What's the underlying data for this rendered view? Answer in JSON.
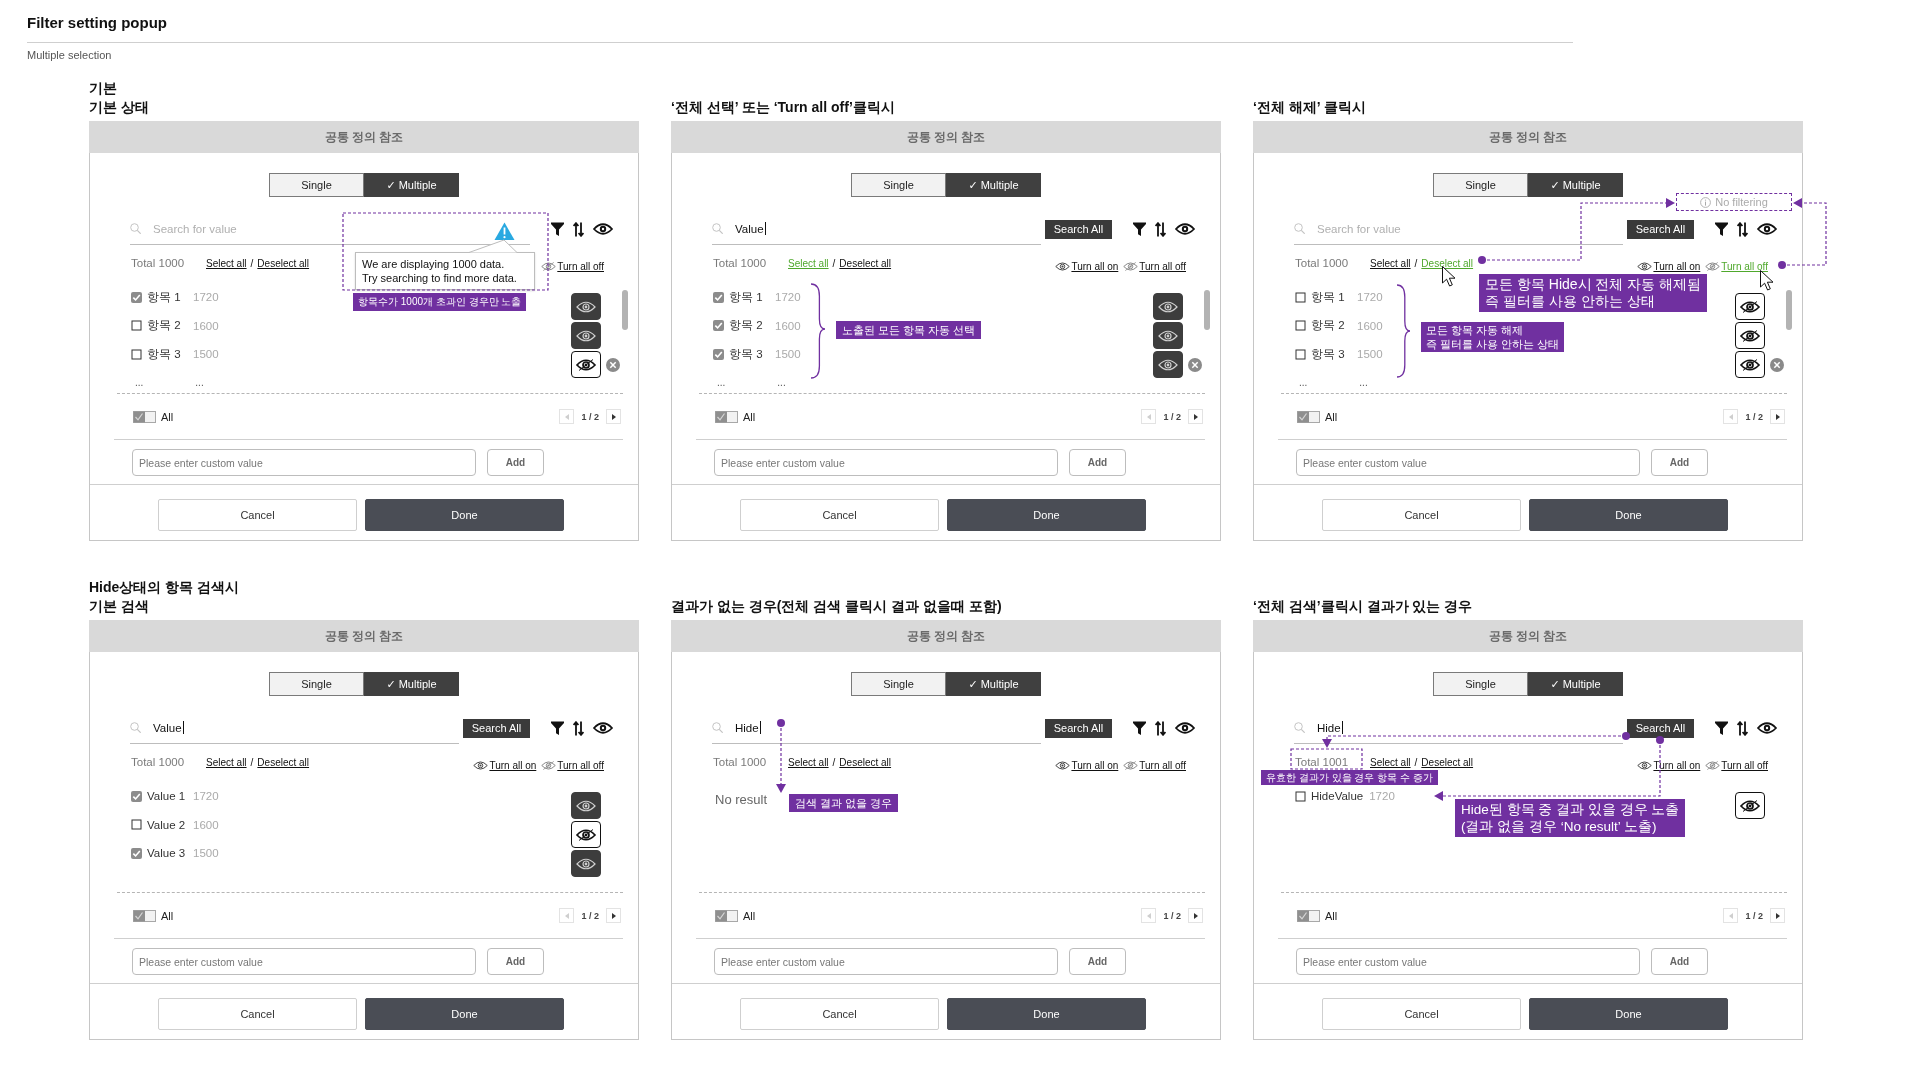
{
  "page": {
    "title": "Filter setting popup",
    "subtitle": "Multiple selection"
  },
  "panels": [
    {
      "headings": [
        "기본",
        "기본 상태"
      ],
      "popup": {
        "header": "공통 정의 참조",
        "modes": [
          {
            "label": "Single",
            "selected": false
          },
          {
            "label": "✓ Multiple",
            "selected": true
          }
        ],
        "search": {
          "placeholder": "Search for value"
        },
        "total": "Total 1000",
        "bulk": {
          "select": {
            "label": "Select all",
            "highlighted": false
          },
          "separator": "/",
          "deselect": {
            "label": "Deselect all",
            "highlighted": false
          }
        },
        "visibility_links": [
          {
            "kind": "off",
            "label": "Turn all off",
            "highlighted": false
          }
        ],
        "items": [
          {
            "label": "항목 1",
            "count": "1720",
            "checked": true,
            "visible": true
          },
          {
            "label": "항목 2",
            "count": "1600",
            "checked": false,
            "visible": true
          },
          {
            "label": "항목 3",
            "count": "1500",
            "checked": false,
            "visible": false
          }
        ],
        "more": [
          "...",
          "..."
        ],
        "remove_icon": true,
        "scrollbar": true,
        "all": {
          "label": "All",
          "checked": true
        },
        "pager": {
          "page": "1 / 2",
          "prev_disabled": true
        },
        "custom": {
          "placeholder": "Please enter custom value",
          "button": "Add"
        },
        "footer": [
          {
            "kind": "secondary",
            "label": "Cancel"
          },
          {
            "kind": "primary",
            "label": "Done"
          }
        ]
      },
      "annotations": [
        {
          "kind": "frame"
        },
        {
          "kind": "warning"
        },
        {
          "kind": "tooltip",
          "text": "We are displaying 1000 data.\nTry searching to find more data."
        },
        {
          "kind": "label",
          "text": "항목수가 1000개 초과인 경우만 노출"
        }
      ]
    },
    {
      "headings": [
        "‘전체 선택’ 또는 ‘Turn all off’클릭시"
      ],
      "popup": {
        "header": "공통 정의 참조",
        "modes": [
          {
            "label": "Single",
            "selected": false
          },
          {
            "label": "✓ Multiple",
            "selected": true
          }
        ],
        "search": {
          "value": "Value",
          "focused": true
        },
        "search_all": "Search All",
        "total": "Total 1000",
        "bulk": {
          "select": {
            "label": "Select all",
            "highlighted": true
          },
          "separator": "/",
          "deselect": {
            "label": "Deselect all",
            "highlighted": false
          }
        },
        "visibility_links": [
          {
            "kind": "on",
            "label": "Turn all on",
            "highlighted": false
          },
          {
            "kind": "off",
            "label": "Turn all off",
            "highlighted": false
          }
        ],
        "items": [
          {
            "label": "항목 1",
            "count": "1720",
            "checked": true,
            "visible": true
          },
          {
            "label": "항목 2",
            "count": "1600",
            "checked": true,
            "visible": true
          },
          {
            "label": "항목 3",
            "count": "1500",
            "checked": true,
            "visible": true
          }
        ],
        "more": [
          "...",
          "..."
        ],
        "remove_icon": true,
        "scrollbar": true,
        "all": {
          "label": "All",
          "checked": true
        },
        "pager": {
          "page": "1 / 2",
          "prev_disabled": true
        },
        "custom": {
          "placeholder": "Please enter custom value",
          "button": "Add"
        },
        "footer": [
          {
            "kind": "secondary",
            "label": "Cancel"
          },
          {
            "kind": "primary",
            "label": "Done"
          }
        ]
      },
      "annotations": [
        {
          "kind": "brace"
        },
        {
          "kind": "label",
          "text": "노출된 모든 항목 자동 선택"
        }
      ]
    },
    {
      "headings": [
        "‘전체 해제’ 클릭시"
      ],
      "popup": {
        "header": "공통 정의 참조",
        "modes": [
          {
            "label": "Single",
            "selected": false
          },
          {
            "label": "✓ Multiple",
            "selected": true
          }
        ],
        "search": {
          "placeholder": "Search for value"
        },
        "search_all": "Search All",
        "total": "Total 1000",
        "bulk": {
          "select": {
            "label": "Select all",
            "highlighted": false
          },
          "separator": "/",
          "deselect": {
            "label": "Deselect all",
            "highlighted": true
          }
        },
        "visibility_links": [
          {
            "kind": "on",
            "label": "Turn all on",
            "highlighted": false
          },
          {
            "kind": "off",
            "label": "Turn all off",
            "highlighted": true
          }
        ],
        "items": [
          {
            "label": "항목 1",
            "count": "1720",
            "checked": false,
            "visible": false
          },
          {
            "label": "항목 2",
            "count": "1600",
            "checked": false,
            "visible": false
          },
          {
            "label": "항목 3",
            "count": "1500",
            "checked": false,
            "visible": false
          }
        ],
        "more": [
          "...",
          "..."
        ],
        "remove_icon": true,
        "scrollbar": true,
        "all": {
          "label": "All",
          "checked": true
        },
        "pager": {
          "page": "1 / 2",
          "prev_disabled": true
        },
        "custom": {
          "placeholder": "Please enter custom value",
          "button": "Add"
        },
        "footer": [
          {
            "kind": "secondary",
            "label": "Cancel"
          },
          {
            "kind": "primary",
            "label": "Done"
          }
        ]
      },
      "annotations": [
        {
          "kind": "note",
          "text": "No filtering"
        },
        {
          "kind": "connector"
        },
        {
          "kind": "connector"
        },
        {
          "kind": "cursor"
        },
        {
          "kind": "cursor"
        },
        {
          "kind": "label",
          "text": "모든 항목 Hide시 전체 자동 해제됨\n즉 필터를 사용 안하는 상태"
        },
        {
          "kind": "brace"
        },
        {
          "kind": "label",
          "text": "모든 항목 자동 해제\n즉 필터를 사용 안하는 상태"
        }
      ]
    },
    {
      "headings": [
        "Hide상태의 항목 검색시",
        "기본 검색"
      ],
      "popup": {
        "header": "공통 정의 참조",
        "modes": [
          {
            "label": "Single",
            "selected": false
          },
          {
            "label": "✓ Multiple",
            "selected": true
          }
        ],
        "search": {
          "value": "Value",
          "focused": true
        },
        "search_all": "Search All",
        "total": "Total 1000",
        "bulk": {
          "select": {
            "label": "Select all",
            "highlighted": false
          },
          "separator": "/",
          "deselect": {
            "label": "Deselect all",
            "highlighted": false
          }
        },
        "visibility_links": [
          {
            "kind": "on",
            "label": "Turn all on",
            "highlighted": false
          },
          {
            "kind": "off",
            "label": "Turn all off",
            "highlighted": false
          }
        ],
        "items": [
          {
            "label": "Value 1",
            "count": "1720",
            "checked": true,
            "visible": true
          },
          {
            "label": "Value 2",
            "count": "1600",
            "checked": false,
            "visible": false
          },
          {
            "label": "Value 3",
            "count": "1500",
            "checked": true,
            "visible": true
          }
        ],
        "all": {
          "label": "All",
          "checked": true
        },
        "pager": {
          "page": "1 / 2",
          "prev_disabled": true
        },
        "custom": {
          "placeholder": "Please enter custom value",
          "button": "Add"
        },
        "footer": [
          {
            "kind": "secondary",
            "label": "Cancel"
          },
          {
            "kind": "primary",
            "label": "Done"
          }
        ]
      }
    },
    {
      "headings": [
        "결과가 없는 경우(전체 검색 클릭시 결과 없을때 포함)"
      ],
      "popup": {
        "header": "공통 정의 참조",
        "modes": [
          {
            "label": "Single",
            "selected": false
          },
          {
            "label": "✓ Multiple",
            "selected": true
          }
        ],
        "search": {
          "value": "Hide",
          "focused": true
        },
        "search_all": "Search All",
        "total": "Total 1000",
        "bulk": {
          "select": {
            "label": "Select all",
            "highlighted": false
          },
          "separator": "/",
          "deselect": {
            "label": "Deselect all",
            "highlighted": false
          }
        },
        "visibility_links": [
          {
            "kind": "on",
            "label": "Turn all on",
            "highlighted": false
          },
          {
            "kind": "off",
            "label": "Turn all off",
            "highlighted": false
          }
        ],
        "no_result": "No result",
        "all": {
          "label": "All",
          "checked": true
        },
        "pager": {
          "page": "1 / 2",
          "prev_disabled": true
        },
        "custom": {
          "placeholder": "Please enter custom value",
          "button": "Add"
        },
        "footer": [
          {
            "kind": "secondary",
            "label": "Cancel"
          },
          {
            "kind": "primary",
            "label": "Done"
          }
        ]
      },
      "annotations": [
        {
          "kind": "connector"
        },
        {
          "kind": "label",
          "text": "검색 결과 없을 경우"
        }
      ]
    },
    {
      "headings": [
        "‘전체 검색’클릭시 결과가 있는 경우"
      ],
      "popup": {
        "header": "공통 정의 참조",
        "modes": [
          {
            "label": "Single",
            "selected": false
          },
          {
            "label": "✓ Multiple",
            "selected": true
          }
        ],
        "search": {
          "value": "Hide",
          "focused": true
        },
        "search_all": "Search All",
        "total": "Total 1001",
        "bulk": {
          "select": {
            "label": "Select all",
            "highlighted": false
          },
          "separator": "/",
          "deselect": {
            "label": "Deselect all",
            "highlighted": false
          }
        },
        "visibility_links": [
          {
            "kind": "on",
            "label": "Turn all on",
            "highlighted": false
          },
          {
            "kind": "off",
            "label": "Turn all off",
            "highlighted": false
          }
        ],
        "items": [
          {
            "label": "HideValue",
            "count": "1720",
            "checked": false,
            "visible": false
          }
        ],
        "all": {
          "label": "All",
          "checked": true
        },
        "pager": {
          "page": "1 / 2",
          "prev_disabled": true
        },
        "custom": {
          "placeholder": "Please enter custom value",
          "button": "Add"
        },
        "footer": [
          {
            "kind": "secondary",
            "label": "Cancel"
          },
          {
            "kind": "primary",
            "label": "Done"
          }
        ]
      },
      "annotations": [
        {
          "kind": "connector"
        },
        {
          "kind": "frame"
        },
        {
          "kind": "label",
          "text": "유효한 결과가 있을 경우 항목 수 증가"
        },
        {
          "kind": "connector"
        },
        {
          "kind": "label",
          "text": "Hide된 항목 중 결과 있을 경우 노출\n(결과 없을 경우 ‘No result’ 노출)"
        }
      ]
    }
  ]
}
